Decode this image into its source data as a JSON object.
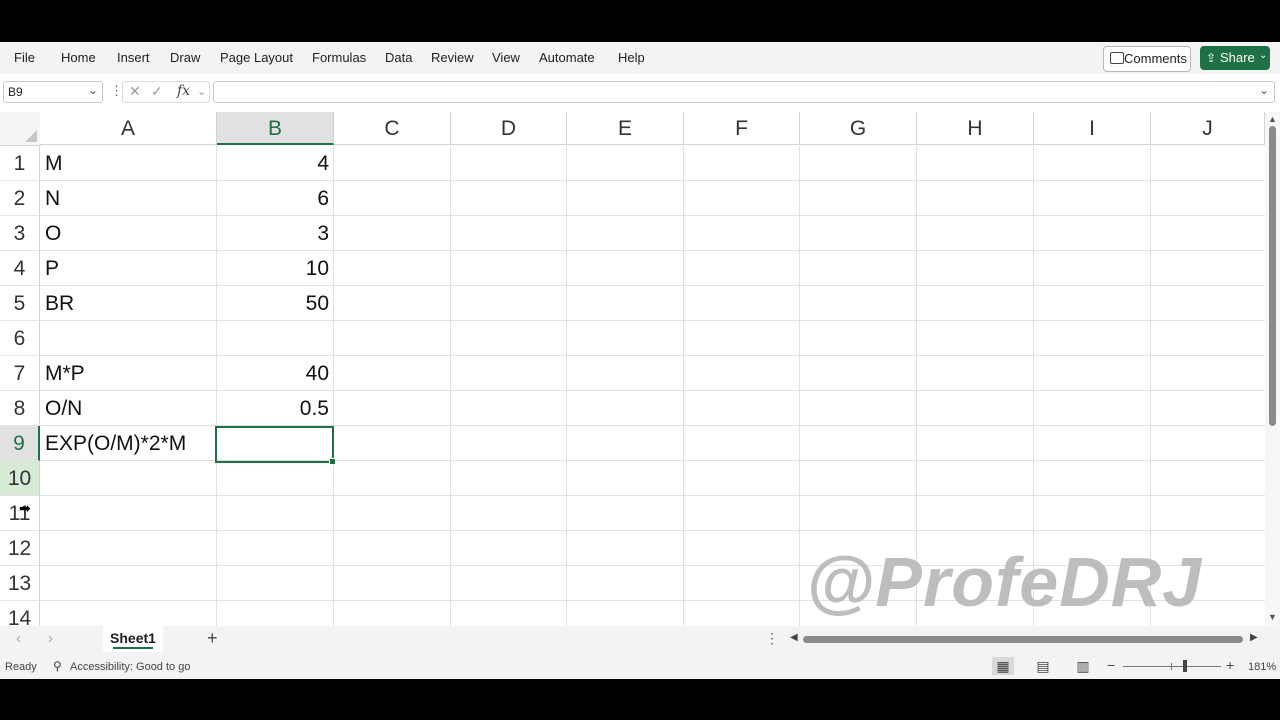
{
  "ribbon": {
    "tabs": [
      "File",
      "Home",
      "Insert",
      "Draw",
      "Page Layout",
      "Formulas",
      "Data",
      "Review",
      "View",
      "Automate",
      "Help"
    ],
    "comments_label": "Comments",
    "share_label": "Share"
  },
  "formula_bar": {
    "name_box": "B9",
    "fx_label": "fx",
    "value": ""
  },
  "columns": [
    "A",
    "B",
    "C",
    "D",
    "E",
    "F",
    "G",
    "H",
    "I",
    "J"
  ],
  "selected_column": "B",
  "rows": [
    {
      "num": "1",
      "a": "M",
      "b": "4"
    },
    {
      "num": "2",
      "a": "N",
      "b": "6"
    },
    {
      "num": "3",
      "a": "O",
      "b": "3"
    },
    {
      "num": "4",
      "a": "P",
      "b": "10"
    },
    {
      "num": "5",
      "a": "BR",
      "b": "50"
    },
    {
      "num": "6",
      "a": "",
      "b": ""
    },
    {
      "num": "7",
      "a": "M*P",
      "b": "40"
    },
    {
      "num": "8",
      "a": "O/N",
      "b": "0.5"
    },
    {
      "num": "9",
      "a": "EXP(O/M)*2*M",
      "b": ""
    },
    {
      "num": "10",
      "a": "",
      "b": ""
    },
    {
      "num": "11",
      "a": "",
      "b": ""
    },
    {
      "num": "12",
      "a": "",
      "b": ""
    },
    {
      "num": "13",
      "a": "",
      "b": ""
    },
    {
      "num": "14",
      "a": "",
      "b": ""
    }
  ],
  "active_cell": "B9",
  "watermark": "@ProfeDRJ",
  "sheets": [
    "Sheet1"
  ],
  "status": {
    "ready": "Ready",
    "accessibility": "Accessibility: Good to go",
    "zoom": "181%"
  },
  "colors": {
    "accent": "#1e7145"
  }
}
